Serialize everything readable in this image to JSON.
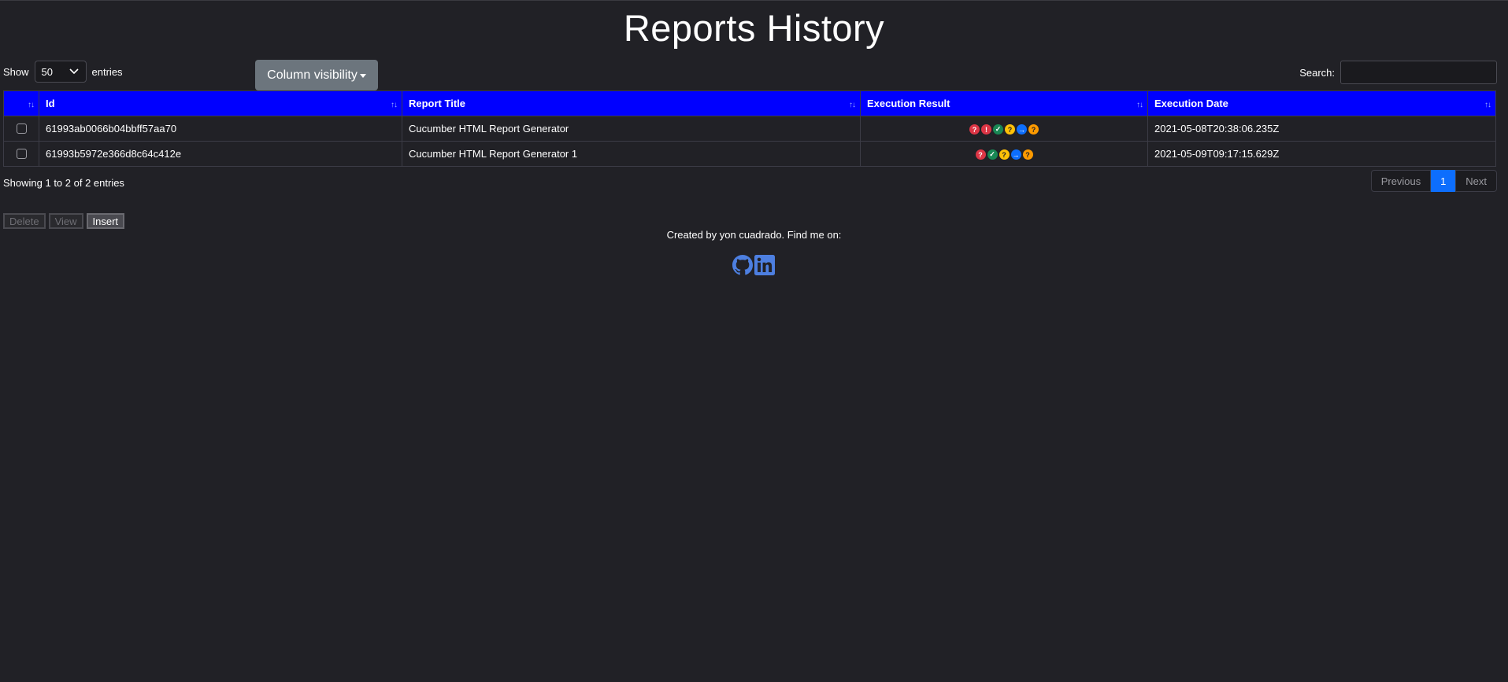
{
  "page": {
    "title": "Reports History"
  },
  "controls": {
    "show_label": "Show",
    "entries_value": "50",
    "entries_label": "entries",
    "column_visibility_label": "Column visibility",
    "search_label": "Search:",
    "search_value": ""
  },
  "table": {
    "columns": [
      "",
      "Id",
      "Report Title",
      "Execution Result",
      "Execution Date"
    ],
    "sort_indicator": "↑↓",
    "rows": [
      {
        "id": "61993ab0066b04bbff57aa70",
        "title": "Cucumber HTML Report Generator",
        "date": "2021-05-08T20:38:06.235Z",
        "results": [
          {
            "icon": "question-icon",
            "symbol": "?",
            "color": "#dc3545"
          },
          {
            "icon": "exclamation-icon",
            "symbol": "!",
            "color": "#dc3545"
          },
          {
            "icon": "check-icon",
            "symbol": "✓",
            "color": "#198754"
          },
          {
            "icon": "question-icon",
            "symbol": "?",
            "color": "#ffc107"
          },
          {
            "icon": "arrow-right-icon",
            "symbol": "→",
            "color": "#0d6efd"
          },
          {
            "icon": "question-icon",
            "symbol": "?",
            "color": "#fd9a00"
          }
        ]
      },
      {
        "id": "61993b5972e366d8c64c412e",
        "title": "Cucumber HTML Report Generator 1",
        "date": "2021-05-09T09:17:15.629Z",
        "results": [
          {
            "icon": "question-icon",
            "symbol": "?",
            "color": "#dc3545"
          },
          {
            "icon": "check-icon",
            "symbol": "✓",
            "color": "#198754"
          },
          {
            "icon": "question-icon",
            "symbol": "?",
            "color": "#ffc107"
          },
          {
            "icon": "arrow-right-icon",
            "symbol": "→",
            "color": "#0d6efd"
          },
          {
            "icon": "question-icon",
            "symbol": "?",
            "color": "#fd9a00"
          }
        ]
      }
    ]
  },
  "info": "Showing 1 to 2 of 2 entries",
  "pagination": {
    "previous": "Previous",
    "current": "1",
    "next": "Next"
  },
  "actions": {
    "delete": "Delete",
    "view": "View",
    "insert": "Insert"
  },
  "footer": {
    "text": "Created by yon cuadrado. Find me on:"
  },
  "colors": {
    "header_bg": "#0000ff",
    "page_bg": "#212126",
    "icon_blue": "#4d7fe0"
  }
}
